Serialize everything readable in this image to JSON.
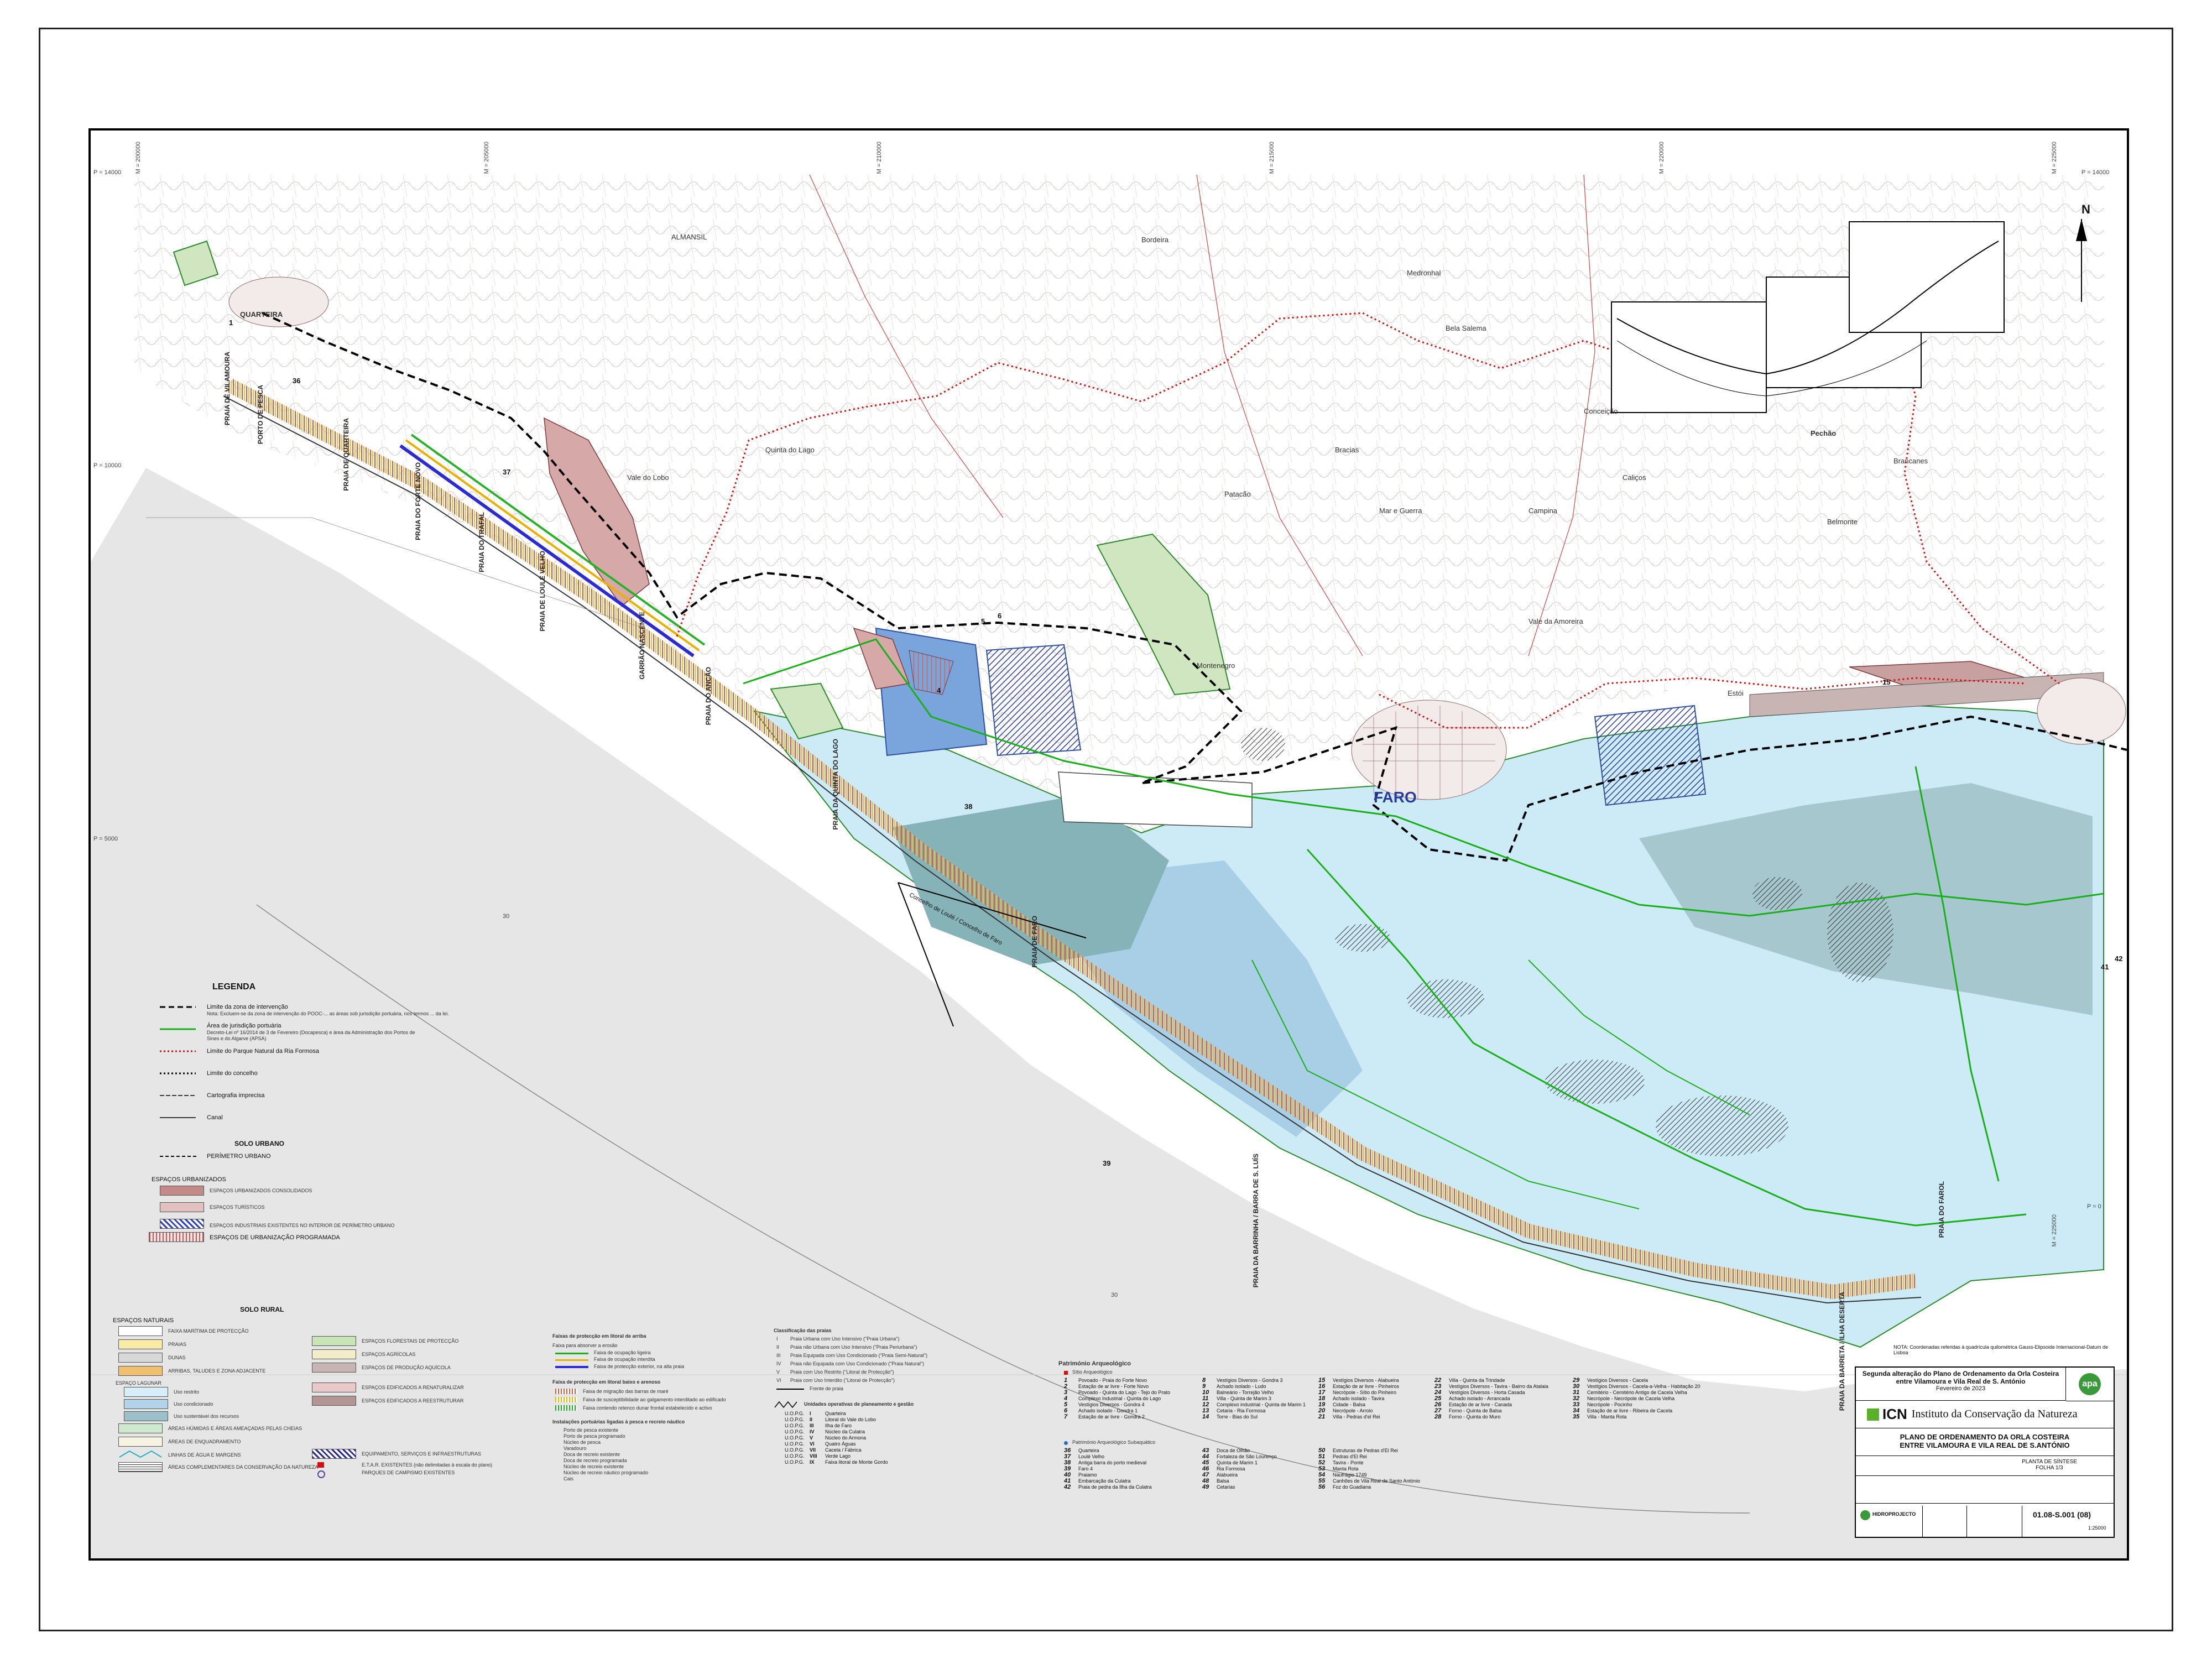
{
  "map": {
    "north_label": "N",
    "coord_top": [
      "M = 200000",
      "M = 205000",
      "M = 210000",
      "M = 215000",
      "M = 220000",
      "M = 225000"
    ],
    "coord_left": [
      "P = 14000",
      "P = 10000",
      "P = 5000"
    ],
    "coord_right": [
      "P = 14000",
      "P = 0"
    ],
    "coord_bottom": [
      "M = 225000"
    ],
    "depth_labels": [
      "30",
      "30"
    ],
    "places": [
      "ALMANSIL",
      "QUARTEIRA",
      "Vale do Lobo",
      "Quinta do Lago",
      "Patacão",
      "Bela Salema",
      "Bordeira",
      "Medronhal",
      "Conceição",
      "Pechão",
      "Brancanes",
      "Montenegro",
      "FARO",
      "Campina",
      "Mar e Guerra",
      "Bracias",
      "Caliços",
      "Vale da Amoreira",
      "Belmonte",
      "Estói"
    ],
    "beaches": [
      "PRAIA DE VILAMOURA",
      "PORTO DE PESCA",
      "PRAIA DE QUARTEIRA",
      "PRAIA DO FORTE NOVO",
      "PRAIA DO TRAFAL",
      "PRAIA DE LOULÉ VELHO",
      "PRAIA DO ANCÃO",
      "PRAIA DA QUINTA DO LAGO",
      "PRAIA DE FARO",
      "GARRÃO NASCENTE",
      "PRAIA DA BARRINHA / BARRA DE S. LUÍS",
      "PRAIA DA BARRETA / ILHA DESERTA",
      "PRAIA DO FAROL"
    ],
    "site_numbers": [
      "1",
      "4",
      "5",
      "6",
      "36",
      "37",
      "38",
      "39",
      "42",
      "41",
      "15"
    ],
    "ruler_label": "Concelho de Loulé / Concelho de Faro",
    "note": "NOTA: Coordenadas referidas à quadrícula quilométrica Gauss-Elipsoide Internacional-Datum de Lisboa"
  },
  "legend": {
    "title": "LEGENDA",
    "items": [
      {
        "label": "Limite da zona de intervenção",
        "note": "Nota: Excluem-se da zona de intervenção do POOC-... as áreas sob jurisdição portuária, nos termos ... da lei."
      },
      {
        "label": "Área de jurisdição portuária",
        "note": "Decreto-Lei nº 16/2014 de 3 de Fevereiro (Docapesca) e área da Administração dos Portos de Sines e do Algarve (APSA)"
      },
      {
        "label": "Limite do Parque Natural da Ria Formosa",
        "note": ""
      },
      {
        "label": "Limite do concelho",
        "note": ""
      },
      {
        "label": "Cartografia imprecisa",
        "note": ""
      },
      {
        "label": "Canal",
        "note": ""
      }
    ],
    "solo_urbano": "SOLO URBANO",
    "perimetro": "PERÍMETRO URBANO",
    "espacos_urbanizados": "ESPAÇOS URBANIZADOS",
    "urb_items": [
      "ESPAÇOS URBANIZADOS CONSOLIDADOS",
      "ESPAÇOS TURÍSTICOS",
      "ESPAÇOS INDUSTRIAIS EXISTENTES NO INTERIOR DE PERÍMETRO URBANO"
    ],
    "urb_prog": "ESPAÇOS DE URBANIZAÇÃO PROGRAMADA",
    "solo_rural": "SOLO RURAL",
    "espacos_naturais": "ESPAÇOS NATURAIS",
    "nat_items": [
      "FAIXA MARÍTIMA DE PROTECÇÃO",
      "PRAIAS",
      "DUNAS",
      "ARRIBAS, TALUDES E ZONA ADJACENTE"
    ],
    "espaco_lagunar": "ESPAÇO LAGUNAR",
    "lag_items": [
      "Uso restrito",
      "Uso condicionado",
      "Uso sustentável dos recursos"
    ],
    "other_items": [
      "ÁREAS HÚMIDAS E ÁREAS AMEAÇADAS PELAS CHEIAS",
      "ÁREAS DE ENQUADRAMENTO",
      "LINHAS DE ÁGUA E MARGENS",
      "ÁREAS COMPLEMENTARES DA CONSERVAÇÃO DA NATUREZA"
    ],
    "col2_items": [
      "ESPAÇOS FLORESTAIS DE PROTECÇÃO",
      "ESPAÇOS AGRÍCOLAS",
      "ESPAÇOS DE PRODUÇÃO AQUÍCOLA",
      "ESPAÇOS EDIFICADOS A RENATURALIZAR",
      "ESPAÇOS EDIFICADOS A REESTRUTURAR",
      "EQUIPAMENTO, SERVIÇOS E INFRAESTRUTURAS",
      "E.T.A.R. EXISTENTES (não delimitadas à escala do plano)",
      "PARQUES DE CAMPISMO EXISTENTES"
    ]
  },
  "faixas": {
    "title1": "Faixas de protecção em litoral de arriba",
    "items1": [
      "Faixa para absorver a erosão",
      "Faixa de ocupação ligeira",
      "Faixa de ocupação interdita",
      "Faixa de protecção exterior, na alta praia"
    ],
    "title2": "Faixa de protecção em litoral baixo e arenoso",
    "items2": [
      "Faixa de migração das barras de maré",
      "Faixa de susceptibilidade ao galgamento interditado ao edificado",
      "Faixa contendo retenco dunar frontal estabelecido e activo"
    ],
    "title3": "Instalações portuárias ligadas à pesca e recreio náutico",
    "items3": [
      "Porto de pesca existente",
      "Porto de pesca programado",
      "Núcleo de pesca",
      "Varadouro",
      "Doca de recreio existente",
      "Doca de recreio programada",
      "Núcleo de recreio existente",
      "Núcleo de recreio náutico programado",
      "Cais"
    ]
  },
  "praias": {
    "title": "Classificação das praias",
    "items": [
      {
        "code": "I",
        "label": "Praia Urbana com Uso Intensivo (\"Praia Urbana\")"
      },
      {
        "code": "II",
        "label": "Praia não Urbana com Uso Intensivo (\"Praia Periurbana\")"
      },
      {
        "code": "III",
        "label": "Praia Equipada com Uso Condicionado (\"Praia Semi-Natural\")"
      },
      {
        "code": "IV",
        "label": "Praia não Equipada com Uso Condicionado (\"Praia Natural\")"
      },
      {
        "code": "V",
        "label": "Praia com Uso Restrito (\"Litoral de Protecção\")"
      },
      {
        "code": "VI",
        "label": "Praia com Uso Interdito (\"Litoral de Protecção\")"
      }
    ],
    "frente": "Frente de praia"
  },
  "uopg": {
    "title": "Unidades operativas de planeamento e gestão",
    "items": [
      {
        "u": "U.O.P.G.",
        "n": "I",
        "label": "Quarteira"
      },
      {
        "u": "U.O.P.G.",
        "n": "II",
        "label": "Litoral do Vale do Lobo"
      },
      {
        "u": "U.O.P.G.",
        "n": "III",
        "label": "Ilha de Faro"
      },
      {
        "u": "U.O.P.G.",
        "n": "IV",
        "label": "Núcleo da Culatra"
      },
      {
        "u": "U.O.P.G.",
        "n": "V",
        "label": "Núcleo do Armona"
      },
      {
        "u": "U.O.P.G.",
        "n": "VI",
        "label": "Quatro Águas"
      },
      {
        "u": "U.O.P.G.",
        "n": "VII",
        "label": "Cacela / Fábrica"
      },
      {
        "u": "U.O.P.G.",
        "n": "VIII",
        "label": "Verde Lago"
      },
      {
        "u": "U.O.P.G.",
        "n": "IX",
        "label": "Faixa litoral de Monte Gordo"
      }
    ]
  },
  "arqueo": {
    "title": "Património Arqueológico",
    "sub1": "Sítio Arqueológico",
    "col1": [
      {
        "n": "1",
        "t": "Povoado - Praia do Forte Novo"
      },
      {
        "n": "2",
        "t": "Estação de ar livre - Forte Novo"
      },
      {
        "n": "3",
        "t": "Povoado - Quinta do Lago - Tejo do Prato"
      },
      {
        "n": "4",
        "t": "Complexo Industrial - Quinta do Lago"
      },
      {
        "n": "5",
        "t": "Vestígios Diversos - Gondra 4"
      },
      {
        "n": "6",
        "t": "Achado isolado - Gondra 1"
      },
      {
        "n": "7",
        "t": "Estação de ar livre - Gondra 2"
      }
    ],
    "col2": [
      {
        "n": "8",
        "t": "Vestígios Diversos - Gondra 3"
      },
      {
        "n": "9",
        "t": "Achado isolado - Ludo"
      },
      {
        "n": "10",
        "t": "Balneário - Torrejão Velho"
      },
      {
        "n": "11",
        "t": "Villa - Quinta de Marim 3"
      },
      {
        "n": "12",
        "t": "Complexo industrial - Quinta de Marim 1"
      },
      {
        "n": "13",
        "t": "Cetaria - Ria Formosa"
      },
      {
        "n": "14",
        "t": "Torre - Bias do Sul"
      }
    ],
    "col3": [
      {
        "n": "15",
        "t": "Vestígios Diversos - Alabueira"
      },
      {
        "n": "16",
        "t": "Estação de ar livre - Pinheiros"
      },
      {
        "n": "17",
        "t": "Necrópole - Sítio do Pinheiro"
      },
      {
        "n": "18",
        "t": "Achado isolado - Tavira"
      },
      {
        "n": "19",
        "t": "Cidade - Balsa"
      },
      {
        "n": "20",
        "t": "Necrópole - Arroio"
      },
      {
        "n": "21",
        "t": "Villa - Pedras d'el Rei"
      }
    ],
    "col4": [
      {
        "n": "22",
        "t": "Villa - Quinta da Trindade"
      },
      {
        "n": "23",
        "t": "Vestígios Diversos - Tavira - Bairro da Atalaia"
      },
      {
        "n": "24",
        "t": "Vestígios Diversos - Horta Casada"
      },
      {
        "n": "25",
        "t": "Achado isolado - Arrancada"
      },
      {
        "n": "26",
        "t": "Estação de ar livre - Canada"
      },
      {
        "n": "27",
        "t": "Forno - Quinta de Balsa"
      },
      {
        "n": "28",
        "t": "Forno - Quinta do Muro"
      }
    ],
    "col5": [
      {
        "n": "29",
        "t": "Vestígios Diversos - Cacela"
      },
      {
        "n": "30",
        "t": "Vestígios Diversos - Cacela-a-Velha - Habitação 20"
      },
      {
        "n": "31",
        "t": "Cemitério - Cemitério Antigo de Cacela Velha"
      },
      {
        "n": "32",
        "t": "Necrópole - Necrópole de Cacela Velha"
      },
      {
        "n": "33",
        "t": "Necrópole - Pocinho"
      },
      {
        "n": "34",
        "t": "Estação de ar livre - Ribeira de Cacela"
      },
      {
        "n": "35",
        "t": "Villa - Manta Rota"
      }
    ],
    "sub2": "Património Arqueológico Subaquático",
    "sub_col1": [
      {
        "n": "36",
        "t": "Quarteira"
      },
      {
        "n": "37",
        "t": "Loulé Velho"
      },
      {
        "n": "38",
        "t": "Antiga barra do porto medieval"
      },
      {
        "n": "39",
        "t": "Faro 4"
      },
      {
        "n": "40",
        "t": "Praiamo"
      },
      {
        "n": "41",
        "t": "Embarcação da Culatra"
      },
      {
        "n": "42",
        "t": "Praia de pedra da Ilha da Culatra"
      }
    ],
    "sub_col2": [
      {
        "n": "43",
        "t": "Doca de Olhão"
      },
      {
        "n": "44",
        "t": "Fortaleza de São Lourenço"
      },
      {
        "n": "45",
        "t": "Quinta de Marim 1"
      },
      {
        "n": "46",
        "t": "Ria Formosa"
      },
      {
        "n": "47",
        "t": "Alabueira"
      },
      {
        "n": "48",
        "t": "Balsa"
      },
      {
        "n": "49",
        "t": "Cetarias"
      }
    ],
    "sub_col3": [
      {
        "n": "50",
        "t": "Estruturas de Pedras d'El Rei"
      },
      {
        "n": "51",
        "t": "Pedras d'El Rei"
      },
      {
        "n": "52",
        "t": "Tavira - Ponte"
      },
      {
        "n": "53",
        "t": "Manta Rota"
      },
      {
        "n": "54",
        "t": "Naufrágio 1749"
      },
      {
        "n": "55",
        "t": "Canhões de Vila Real de Santo António"
      },
      {
        "n": "56",
        "t": "Foz do Guadiana"
      }
    ]
  },
  "titleblock": {
    "heading": "Segunda alteração do Plano de Ordenamento da Orla Costeira entre Vilamoura e Vila Real de S. António",
    "date": "Fevereiro de 2023",
    "org": "Instituto da Conservação da Natureza",
    "org_short": "ICN",
    "apa": "apa",
    "plan_title": "PLANO DE ORDENAMENTO DA ORLA COSTEIRA",
    "plan_sub": "ENTRE VILAMOURA E VILA REAL DE S.ANTÓNIO",
    "sheet_name": "PLANTA DE SÍNTESE",
    "sheet_folha": "FOLHA 1/3",
    "drawing_no": "01.08-S.001 (08)",
    "scale": "1:25000",
    "company": "HIDROPROJECTO"
  }
}
